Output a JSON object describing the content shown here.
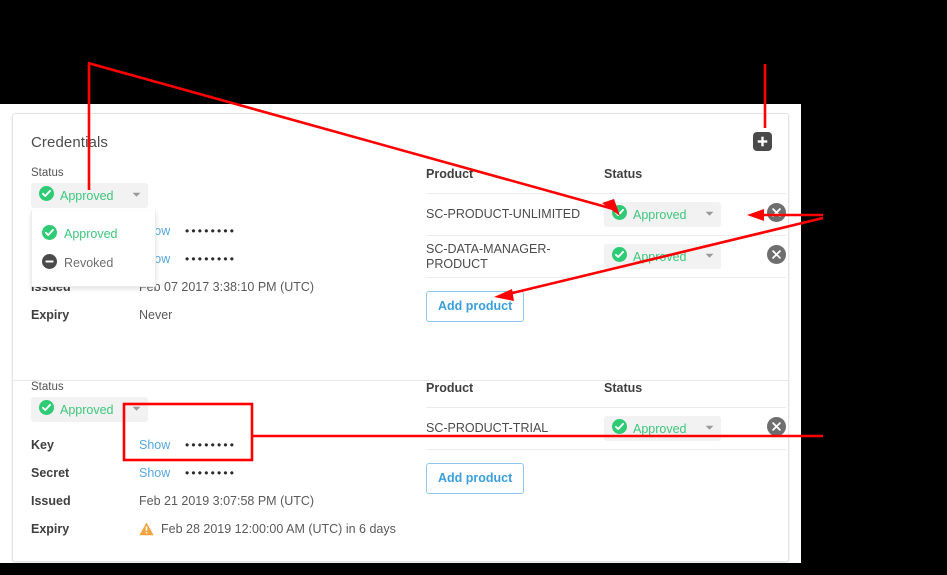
{
  "card": {
    "title": "Credentials",
    "add_credential_icon": "plus-square-icon"
  },
  "labels": {
    "status": "Status",
    "key": "Key",
    "secret": "Secret",
    "issued": "Issued",
    "expiry": "Expiry",
    "product_column": "Product",
    "status_column": "Status",
    "show": "Show",
    "add_product": "Add product",
    "masked_value": "••••••••"
  },
  "icons": {
    "approved": "check-circle-icon",
    "revoked": "minus-circle-icon",
    "caret": "chevron-down-icon",
    "delete": "remove-circle-icon",
    "warning": "warning-triangle-icon",
    "add": "plus-icon"
  },
  "colors": {
    "approved_green": "#3fc77d",
    "link_blue": "#3a9fdb",
    "warning_orange": "#f5a33c",
    "annotation_red": "#ff0000",
    "revoked_gray": "#4a4a4a"
  },
  "status_dropdown": {
    "selected": "Approved",
    "open": true,
    "options": [
      {
        "label": "Approved",
        "icon": "check-circle-icon",
        "state": "approved"
      },
      {
        "label": "Revoked",
        "icon": "minus-circle-icon",
        "state": "revoked"
      }
    ]
  },
  "credentials": [
    {
      "status": "Approved",
      "key_masked": "••••••••",
      "secret_masked": "••••••••",
      "issued": "Feb 07 2017 3:38:10 PM (UTC)",
      "expiry": "Never",
      "expiry_warning": false,
      "products": [
        {
          "name": "SC-PRODUCT-UNLIMITED",
          "status": "Approved"
        },
        {
          "name": "SC-DATA-MANAGER-PRODUCT",
          "status": "Approved"
        }
      ]
    },
    {
      "status": "Approved",
      "key_masked": "••••••••",
      "secret_masked": "••••••••",
      "issued": "Feb 21 2019 3:07:58 PM (UTC)",
      "expiry": "Feb 28 2019 12:00:00 AM (UTC) in 6 days",
      "expiry_warning": true,
      "products": [
        {
          "name": "SC-PRODUCT-TRIAL",
          "status": "Approved"
        }
      ]
    }
  ]
}
